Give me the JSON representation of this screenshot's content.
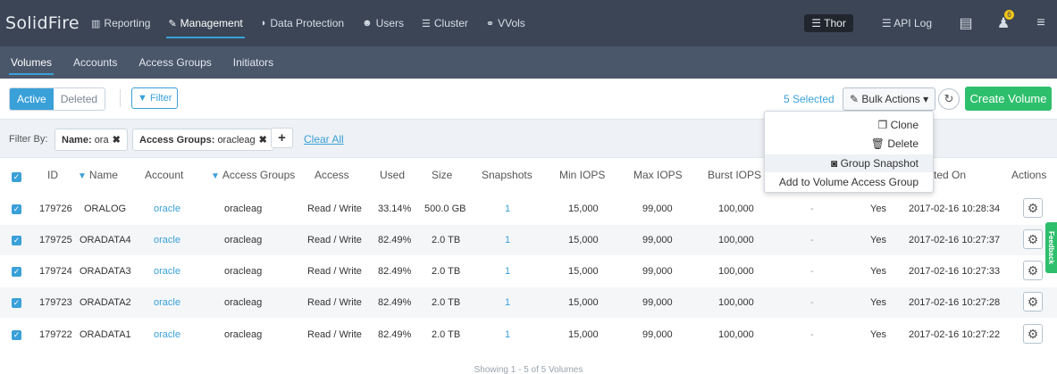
{
  "app": {
    "brand": "SolidFire"
  },
  "topnav": {
    "items": [
      {
        "label": "Reporting",
        "icon": "bar-chart-icon"
      },
      {
        "label": "Management",
        "icon": "wrench-icon"
      },
      {
        "label": "Data Protection",
        "icon": "shield-icon"
      },
      {
        "label": "Users",
        "icon": "users-icon"
      },
      {
        "label": "Cluster",
        "icon": "server-icon"
      },
      {
        "label": "VVols",
        "icon": "vvols-icon"
      }
    ],
    "active": "Management",
    "cluster_name": "Thor",
    "api_log": "API Log",
    "notification_count": "6"
  },
  "subnav": {
    "items": [
      "Volumes",
      "Accounts",
      "Access Groups",
      "Initiators"
    ],
    "active": "Volumes"
  },
  "toolbar": {
    "active_label": "Active",
    "deleted_label": "Deleted",
    "filter_label": "Filter",
    "selected_text": "5 Selected",
    "bulk_actions_label": "Bulk Actions",
    "create_label": "Create Volume"
  },
  "filterbar": {
    "label": "Filter By:",
    "chips": [
      {
        "key": "Name:",
        "value": "ora"
      },
      {
        "key": "Access Groups:",
        "value": "oracleag"
      }
    ],
    "add_label": "+",
    "clear_label": "Clear All"
  },
  "bulk_menu": {
    "items": [
      "Clone",
      "Delete",
      "Group Snapshot",
      "Add to Volume Access Group"
    ],
    "highlighted": "Group Snapshot"
  },
  "table": {
    "headers": {
      "id": "ID",
      "name": "Name",
      "account": "Account",
      "access_groups": "Access Groups",
      "access": "Access",
      "used": "Used",
      "size": "Size",
      "snapshots": "Snapshots",
      "min_iops": "Min IOPS",
      "max_iops": "Max IOPS",
      "burst_iops": "Burst IOPS",
      "created_on": "Created On",
      "actions": "Actions"
    },
    "rows": [
      {
        "id": "179726",
        "name": "ORALOG",
        "account": "oracle",
        "group": "oracleag",
        "access": "Read / Write",
        "used": "33.14%",
        "size": "500.0 GB",
        "snapshots": "1",
        "min": "15,000",
        "max": "99,000",
        "burst": "100,000",
        "dash": "-",
        "yes": "Yes",
        "created": "2017-02-16 10:28:34"
      },
      {
        "id": "179725",
        "name": "ORADATA4",
        "account": "oracle",
        "group": "oracleag",
        "access": "Read / Write",
        "used": "82.49%",
        "size": "2.0 TB",
        "snapshots": "1",
        "min": "15,000",
        "max": "99,000",
        "burst": "100,000",
        "dash": "-",
        "yes": "Yes",
        "created": "2017-02-16 10:27:37"
      },
      {
        "id": "179724",
        "name": "ORADATA3",
        "account": "oracle",
        "group": "oracleag",
        "access": "Read / Write",
        "used": "82.49%",
        "size": "2.0 TB",
        "snapshots": "1",
        "min": "15,000",
        "max": "99,000",
        "burst": "100,000",
        "dash": "-",
        "yes": "Yes",
        "created": "2017-02-16 10:27:33"
      },
      {
        "id": "179723",
        "name": "ORADATA2",
        "account": "oracle",
        "group": "oracleag",
        "access": "Read / Write",
        "used": "82.49%",
        "size": "2.0 TB",
        "snapshots": "1",
        "min": "15,000",
        "max": "99,000",
        "burst": "100,000",
        "dash": "-",
        "yes": "Yes",
        "created": "2017-02-16 10:27:28"
      },
      {
        "id": "179722",
        "name": "ORADATA1",
        "account": "oracle",
        "group": "oracleag",
        "access": "Read / Write",
        "used": "82.49%",
        "size": "2.0 TB",
        "snapshots": "1",
        "min": "15,000",
        "max": "99,000",
        "burst": "100,000",
        "dash": "-",
        "yes": "Yes",
        "created": "2017-02-16 10:27:22"
      }
    ],
    "footer": "Showing 1 - 5 of 5 Volumes"
  },
  "feedback_label": "Feedback",
  "colors": {
    "accent": "#3aa0d8",
    "nav": "#3b4555",
    "subnav": "#4a566a",
    "create": "#2ebf6c"
  }
}
